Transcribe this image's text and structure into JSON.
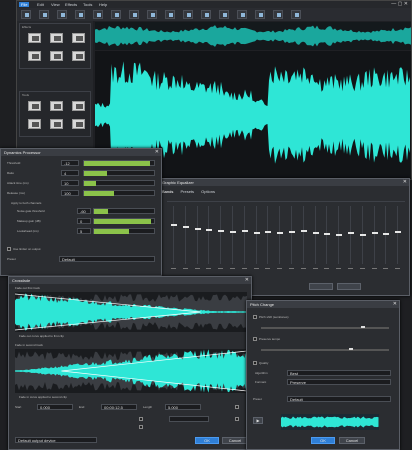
{
  "menu_bar": {
    "items": [
      "File",
      "Edit",
      "View",
      "Effects",
      "Tools",
      "Help"
    ]
  },
  "toolbar": {
    "tools": [
      "open-icon",
      "save-icon",
      "undo-icon",
      "redo-icon",
      "cut-icon",
      "copy-icon",
      "paste-icon",
      "delete-icon",
      "trim-icon",
      "silence-icon",
      "normalize-icon",
      "amplify-icon",
      "fade-in-icon",
      "fade-out-icon",
      "record-icon",
      "play-icon"
    ]
  },
  "sidebar": {
    "section1_title": "Effects",
    "section2_title": "Tools"
  },
  "dynamics_dialog": {
    "title": "Dynamics Processor",
    "rows": [
      {
        "label": "Threshold",
        "value": "-12",
        "fill": 0.95
      },
      {
        "label": "Ratio",
        "value": "4",
        "fill": 0.35
      },
      {
        "label": "Attack time (ms)",
        "value": "10",
        "fill": 0.2
      },
      {
        "label": "Release (ms)",
        "value": "100",
        "fill": 0.45
      }
    ],
    "group_label": "Apply to both channels",
    "subrows": [
      {
        "label": "Noise gate threshold",
        "value": "-60",
        "fill": 0.25
      },
      {
        "label": "Makeup gain (dB)",
        "value": "0",
        "fill": 0.95
      },
      {
        "label": "Lookahead (ms)",
        "value": "5",
        "fill": 0.6
      }
    ],
    "checkbox_label": "Use limiter on output",
    "preset_label": "Preset",
    "preset_value": "Default"
  },
  "eq_dialog": {
    "title": "Graphic Equalizer",
    "tabs": [
      "Bands",
      "Presets",
      "Options"
    ],
    "band_count": 20
  },
  "fade_dialog": {
    "title": "Crossfade",
    "section1": "Fade out first track",
    "section2": "Fade in second track",
    "caption1": "Fade out curve applied to first clip",
    "caption2": "Fade in curve applied to second clip",
    "fields": [
      {
        "label": "Start",
        "value": "0.000"
      },
      {
        "label": "End",
        "value": "00:00:12.5"
      },
      {
        "label": "Length",
        "value": "5.000"
      }
    ],
    "device_value": "Default output device",
    "ok": "OK",
    "cancel": "Cancel"
  },
  "pitch_dialog": {
    "title": "Pitch Change",
    "slider1_label": "Pitch shift (semitones)",
    "slider2_label": "Preserve tempo",
    "opt_label": "Quality",
    "rows": [
      {
        "label": "Algorithm",
        "value": "Best"
      },
      {
        "label": "Formant",
        "value": "Preserve"
      }
    ],
    "preset_label": "Preset",
    "preset_value": "Default",
    "ok": "OK",
    "cancel": "Cancel"
  },
  "colors": {
    "waveform": "#2ee6d6",
    "waveform_dark": "#1aa79d",
    "accent": "#8bc34a",
    "primary_button": "#2f7fd6"
  }
}
